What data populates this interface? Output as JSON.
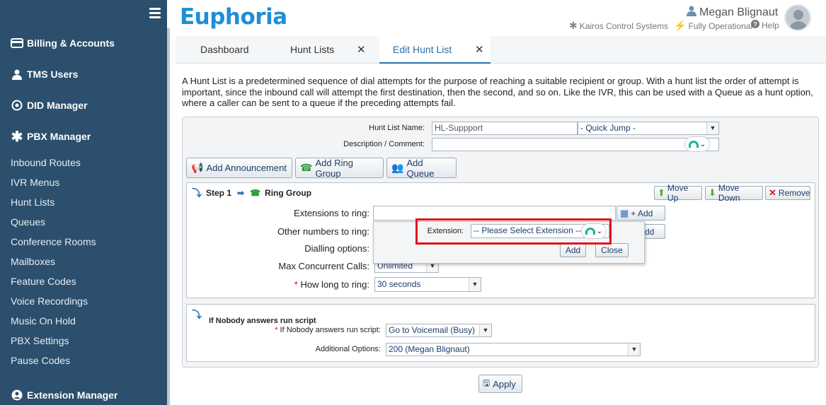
{
  "sidebar": {
    "sections": [
      {
        "label": "Billing & Accounts",
        "icon": "billing-icon"
      },
      {
        "label": "TMS Users",
        "icon": "user-icon"
      },
      {
        "label": "DID Manager",
        "icon": "target-icon"
      },
      {
        "label": "PBX Manager",
        "icon": "asterisk-icon"
      }
    ],
    "items": [
      "Inbound Routes",
      "IVR Menus",
      "Hunt Lists",
      "Queues",
      "Conference Rooms",
      "Mailboxes",
      "Feature Codes",
      "Voice Recordings",
      "Music On Hold",
      "PBX Settings",
      "Pause Codes"
    ],
    "bottom_section": {
      "label": "Extension Manager",
      "icon": "person-circle-icon"
    }
  },
  "header": {
    "logo": "Euphoria",
    "user_name": "Megan Blignaut",
    "company": "Kairos Control Systems",
    "status": "Fully Operational",
    "help": "Help",
    "status_color": "#7dc242"
  },
  "tabs": [
    {
      "label": "Dashboard",
      "closable": false
    },
    {
      "label": "Hunt Lists",
      "closable": true,
      "close": "✕"
    },
    {
      "label": "Edit Hunt List",
      "closable": true,
      "close": "✕",
      "active": true
    }
  ],
  "intro": "A Hunt List is a predetermined sequence of dial attempts for the purpose of reaching a suitable recipient or group. With a hunt list the order of attempt is important, since the inbound call will attempt the first destination, then the second, and so on. Like the IVR, this can be used with a Queue as a hunt option, where a caller can be sent to a queue if the preceding attempts fail.",
  "form": {
    "name_label": "Hunt List Name:",
    "name_value": "HL-Suppport",
    "quick_jump": "- Quick Jump -",
    "description_label": "Description / Comment:",
    "description_value": ""
  },
  "actions": {
    "add_announcement": "Add Announcement",
    "add_ring_group": "Add Ring Group",
    "add_queue": "Add Queue"
  },
  "step": {
    "title": "Step 1",
    "type": "Ring Group",
    "move_up": "Move Up",
    "move_down": "Move Down",
    "remove": "Remove",
    "extensions_label": "Extensions to ring:",
    "extensions_add": "+ Add",
    "other_numbers_label": "Other numbers to ring:",
    "other_add_partial": "dd",
    "dialling_label": "Dialling options:",
    "max_calls_label": "Max Concurrent Calls:",
    "max_calls_value": "Unlimited",
    "how_long_label": "How long to ring:",
    "how_long_value": "30 seconds"
  },
  "popup": {
    "extension_label": "Extension:",
    "extension_placeholder": "-- Please Select Extension --",
    "add": "Add",
    "close": "Close"
  },
  "script": {
    "title": "If Nobody answers run script",
    "run_label": "If Nobody answers run script:",
    "run_value": "Go to Voicemail (Busy)",
    "options_label": "Additional Options:",
    "options_value": "200 (Megan Blignaut)"
  },
  "apply": "Apply"
}
